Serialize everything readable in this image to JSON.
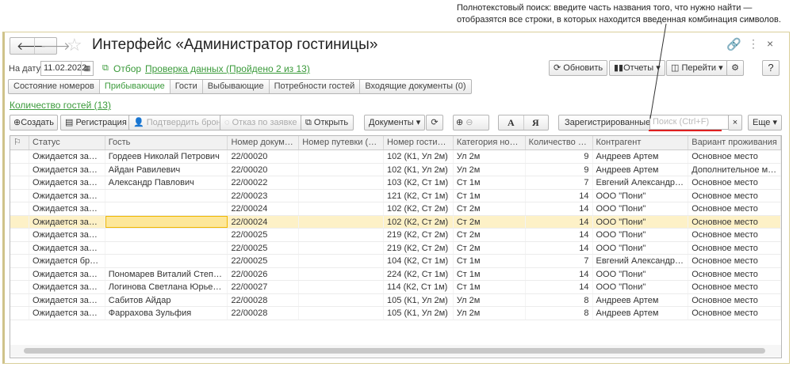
{
  "annotation": {
    "line1": "Полнотекстовый поиск: введите часть названия того, что нужно найти —",
    "line2": "отобразятся  все строки, в которых находится введенная комбинация символов."
  },
  "window": {
    "title": "Интерфейс «Администратор гостиницы»"
  },
  "filter": {
    "date_label": "На дату:",
    "date_value": "11.02.2022",
    "selection": "Отбор",
    "data_check": "Проверка данных (Пройдено 2 из 13)"
  },
  "top_buttons": {
    "refresh": "Обновить",
    "reports": "Отчеты",
    "goto": "Перейти",
    "help": "?"
  },
  "tabs": [
    {
      "label": "Состояние номеров"
    },
    {
      "label": "Прибывающие"
    },
    {
      "label": "Гости"
    },
    {
      "label": "Выбывающие"
    },
    {
      "label": "Потребности гостей"
    },
    {
      "label": "Входящие документы (0)"
    }
  ],
  "guests_link": "Количество гостей (13)",
  "toolbar": {
    "create": "Создать",
    "register": "Регистрация",
    "confirm": "Подтвердить бронь",
    "refuse": "Отказ по заявке",
    "open": "Открыть",
    "documents": "Документы",
    "font_a": "A",
    "font_ya": "Я",
    "registered": "Зарегистрированные",
    "search_placeholder": "Поиск (Ctrl+F)",
    "clear": "×",
    "more": "Еще"
  },
  "table": {
    "columns": [
      "Статус",
      "Гость",
      "Номер документа",
      "Номер путевки (БСО)",
      "Номер гостиницы",
      "Категория номера",
      "Количество дней",
      "Контрагент",
      "Вариант проживания"
    ],
    "rows": [
      [
        "Ожидается заезд",
        "Гордеев Николай Петрович",
        "22/00020",
        "",
        "102 (К1, Ул 2м)",
        "Ул 2м",
        "9",
        "Андреев Артем",
        "Основное место"
      ],
      [
        "Ожидается заезд",
        "Айдан Равилевич",
        "22/00020",
        "",
        "102 (К1, Ул 2м)",
        "Ул 2м",
        "9",
        "Андреев Артем",
        "Дополнительное мес..."
      ],
      [
        "Ожидается заезд",
        "Александр Павлович",
        "22/00022",
        "",
        "103 (К2, Ст 1м)",
        "Ст 1м",
        "7",
        "Евгений Александрович",
        "Основное место"
      ],
      [
        "Ожидается заезд",
        "",
        "22/00023",
        "",
        "121 (К2, Ст 1м)",
        "Ст 1м",
        "14",
        "ООО \"Пони\"",
        "Основное место"
      ],
      [
        "Ожидается заезд",
        "",
        "22/00024",
        "",
        "102 (К2, Ст 2м)",
        "Ст 2м",
        "14",
        "ООО \"Пони\"",
        "Основное место"
      ],
      [
        "Ожидается заезд",
        "",
        "22/00024",
        "",
        "102 (К2, Ст 2м)",
        "Ст 2м",
        "14",
        "ООО \"Пони\"",
        "Основное место"
      ],
      [
        "Ожидается заезд",
        "",
        "22/00025",
        "",
        "219 (К2, Ст 2м)",
        "Ст 2м",
        "14",
        "ООО \"Пони\"",
        "Основное место"
      ],
      [
        "Ожидается заезд",
        "",
        "22/00025",
        "",
        "219 (К2, Ст 2м)",
        "Ст 2м",
        "14",
        "ООО \"Пони\"",
        "Основное место"
      ],
      [
        "Ожидается бронь",
        "",
        "22/00025",
        "",
        "104 (К2, Ст 1м)",
        "Ст 1м",
        "7",
        "Евгений Александрович",
        "Основное место"
      ],
      [
        "Ожидается заезд",
        "Пономарев Виталий Степанович",
        "22/00026",
        "",
        "224 (К2, Ст 1м)",
        "Ст 1м",
        "14",
        "ООО \"Пони\"",
        "Основное место"
      ],
      [
        "Ожидается заезд",
        "Логинова Светлана Юрьевна",
        "22/00027",
        "",
        "114 (К2, Ст 1м)",
        "Ст 1м",
        "14",
        "ООО \"Пони\"",
        "Основное место"
      ],
      [
        "Ожидается заезд",
        "Сабитов Айдар",
        "22/00028",
        "",
        "105 (К1, Ул 2м)",
        "Ул 2м",
        "8",
        "Андреев Артем",
        "Основное место"
      ],
      [
        "Ожидается заезд",
        "Фаррахова Зульфия",
        "22/00028",
        "",
        "105 (К1, Ул 2м)",
        "Ул 2м",
        "8",
        "Андреев Артем",
        "Основное место"
      ]
    ],
    "selected_row": 5
  }
}
